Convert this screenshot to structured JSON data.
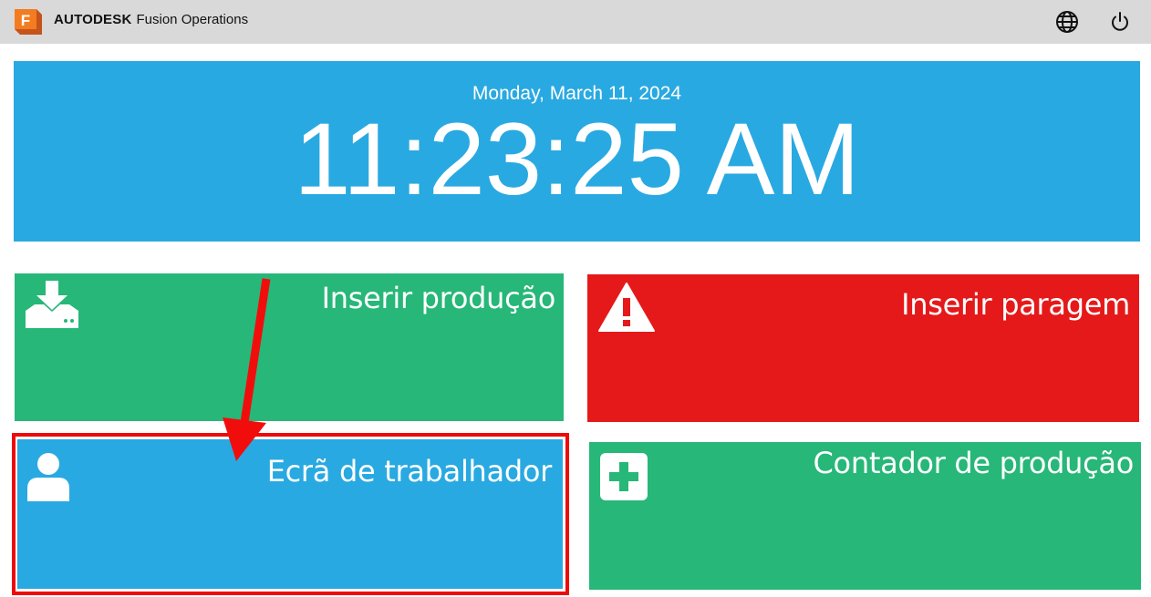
{
  "header": {
    "brand_name": "AUTODESK",
    "product_name": "Fusion Operations",
    "logo_letter": "F",
    "logo_icon": "fusion-logo-icon",
    "language_icon": "globe-icon",
    "power_icon": "power-icon"
  },
  "clock": {
    "date": "Monday, March 11, 2024",
    "time": "11:23:25 AM"
  },
  "tiles": [
    {
      "label": "Inserir produção",
      "icon": "download-tray-icon",
      "color": "#27b778"
    },
    {
      "label": "Inserir paragem",
      "icon": "warning-icon",
      "color": "#e5191a"
    },
    {
      "label": "Ecrã de trabalhador",
      "icon": "user-icon",
      "color": "#29a9e1"
    },
    {
      "label": "Contador de produção",
      "icon": "plus-square-icon",
      "color": "#27b778"
    }
  ],
  "colors": {
    "topbar": "#d9d9d9",
    "clock_panel": "#29a9e1",
    "highlight": "#ee0a0a"
  }
}
